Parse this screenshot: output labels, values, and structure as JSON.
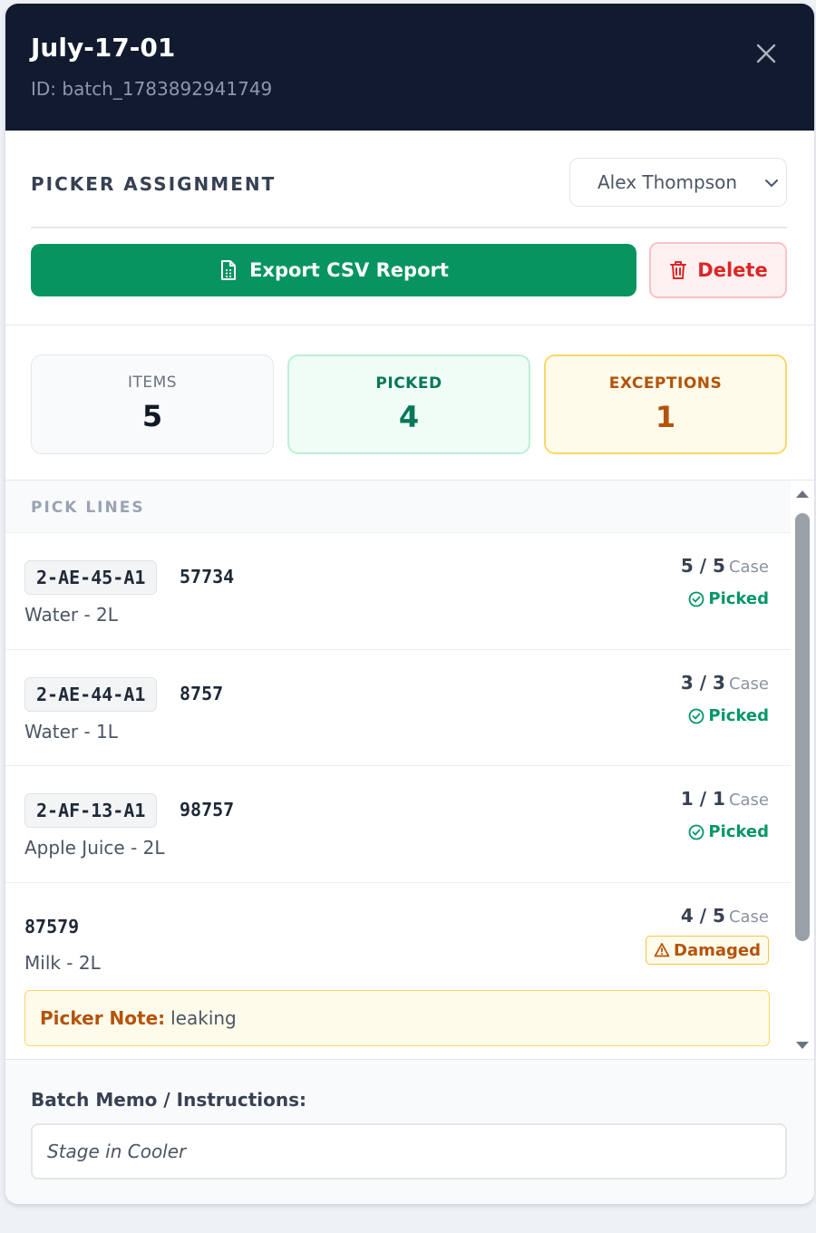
{
  "header": {
    "title": "July-17-01",
    "subtitle": "ID: batch_1783892941749"
  },
  "assignment": {
    "label": "PICKER ASSIGNMENT",
    "selected_picker": "Alex Thompson"
  },
  "actions": {
    "export_label": "Export CSV Report",
    "delete_label": "Delete"
  },
  "stats": {
    "items_label": "ITEMS",
    "items_value": "5",
    "picked_label": "PICKED",
    "picked_value": "4",
    "exceptions_label": "EXCEPTIONS",
    "exceptions_value": "1"
  },
  "pick_lines": {
    "label": "PICK LINES",
    "rows": [
      {
        "location": "2-AE-45-A1",
        "sku": "57734",
        "name": "Water - 2L",
        "picked": "5",
        "ordered": "5",
        "unit": "Case",
        "status": "Picked"
      },
      {
        "location": "2-AE-44-A1",
        "sku": "8757",
        "name": "Water - 1L",
        "picked": "3",
        "ordered": "3",
        "unit": "Case",
        "status": "Picked"
      },
      {
        "location": "2-AF-13-A1",
        "sku": "98757",
        "name": "Apple Juice - 2L",
        "picked": "1",
        "ordered": "1",
        "unit": "Case",
        "status": "Picked"
      },
      {
        "location": "",
        "sku": "87579",
        "name": "Milk - 2L",
        "picked": "4",
        "ordered": "5",
        "unit": "Case",
        "status": "Damaged",
        "note_label": "Picker Note:",
        "note": "leaking"
      }
    ]
  },
  "memo": {
    "label": "Batch Memo / Instructions:",
    "value": "Stage in Cooler"
  },
  "colors": {
    "header_bg": "#111a2e",
    "export_green": "#079461",
    "delete_red": "#dc2626",
    "picked_green": "#059669",
    "exception_amber": "#b45309"
  }
}
